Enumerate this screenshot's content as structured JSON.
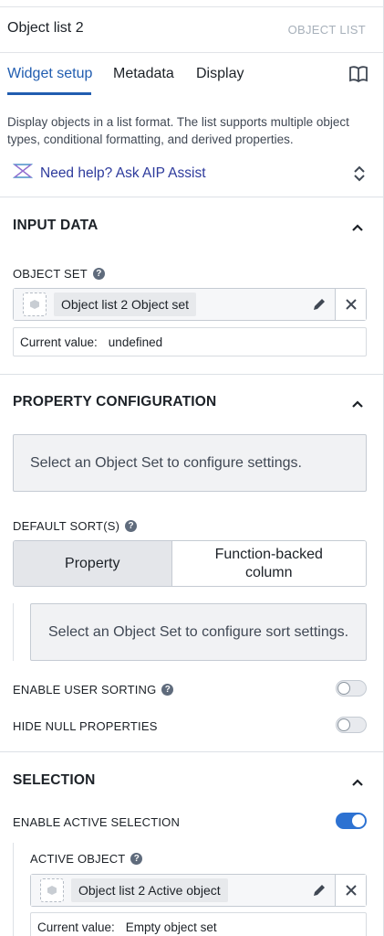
{
  "header": {
    "title": "Object list 2",
    "badge": "OBJECT LIST"
  },
  "tabs": [
    {
      "label": "Widget setup",
      "active": true
    },
    {
      "label": "Metadata",
      "active": false
    },
    {
      "label": "Display",
      "active": false
    }
  ],
  "description": "Display objects in a list format. The list supports multiple object types, conditional formatting, and derived properties.",
  "help_link": "Need help? Ask AIP Assist",
  "input_data": {
    "heading": "INPUT DATA",
    "object_set_label": "OBJECT SET",
    "object_set_value": "Object list 2 Object set",
    "current_label": "Current value:",
    "current_value": "undefined"
  },
  "property_config": {
    "heading": "PROPERTY CONFIGURATION",
    "callout": "Select an Object Set to configure settings.",
    "default_sort_label": "DEFAULT SORT(S)",
    "sort_options": [
      "Property",
      "Function-backed column"
    ],
    "sort_selected": "Property",
    "sort_callout": "Select an Object Set to configure sort settings.",
    "enable_user_sorting_label": "ENABLE USER SORTING",
    "enable_user_sorting": false,
    "hide_null_label": "HIDE NULL PROPERTIES",
    "hide_null": false
  },
  "selection": {
    "heading": "SELECTION",
    "enable_active_label": "ENABLE ACTIVE SELECTION",
    "enable_active": true,
    "active_object_label": "ACTIVE OBJECT",
    "active_object_value": "Object list 2 Active object",
    "current_label": "Current value:",
    "current_value": "Empty object set"
  },
  "colors": {
    "accent": "#215db0",
    "toggle_on": "#2d72d2",
    "help_text": "#2d3a9c"
  }
}
